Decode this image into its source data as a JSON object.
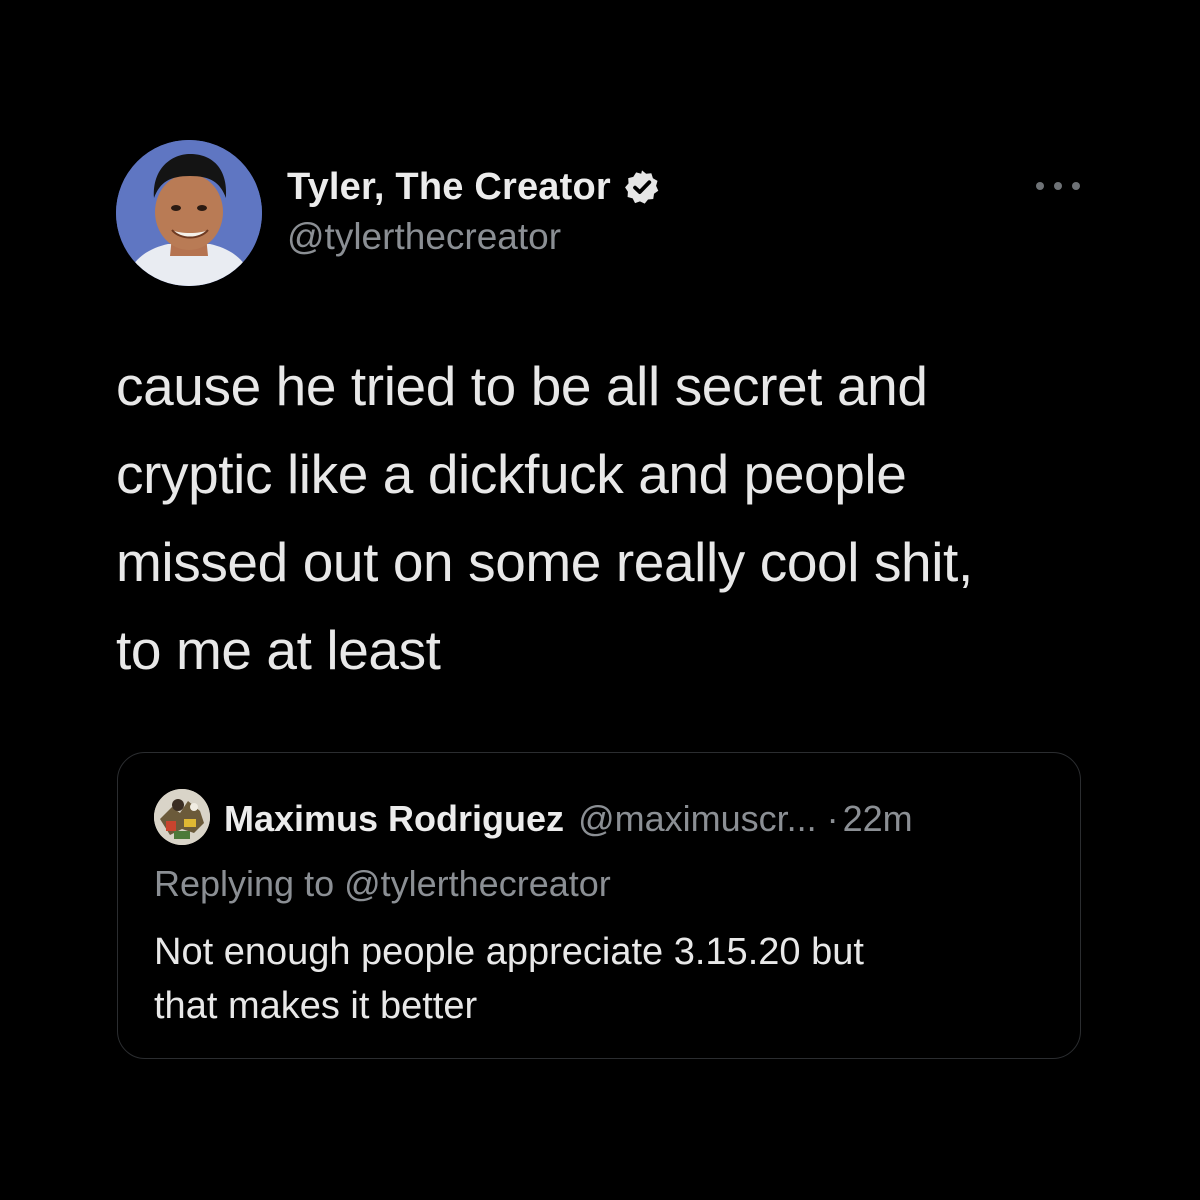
{
  "tweet": {
    "author": {
      "name": "Tyler, The Creator",
      "handle": "@tylerthecreator",
      "verified": true,
      "avatar_icon": "profile-photo"
    },
    "more_icon": "ellipsis-icon",
    "text_lines": [
      "cause he tried to be all secret and",
      "cryptic like a dickfuck and people",
      "missed out on some really cool shit,",
      "to me at least"
    ]
  },
  "quoted_tweet": {
    "author_name": "Maximus Rodriguez",
    "author_handle": "@maximuscr...",
    "separator": "·",
    "time": "22m",
    "replying_to": "Replying to @tylerthecreator",
    "text_lines": [
      "Not enough people appreciate 3.15.20 but",
      "that makes it better"
    ]
  },
  "colors": {
    "background": "#000000",
    "primary_text": "#e8e8e8",
    "secondary_text": "#8b8f94",
    "card_border": "#2b2d30",
    "verified_badge": "#e6e6e6"
  }
}
